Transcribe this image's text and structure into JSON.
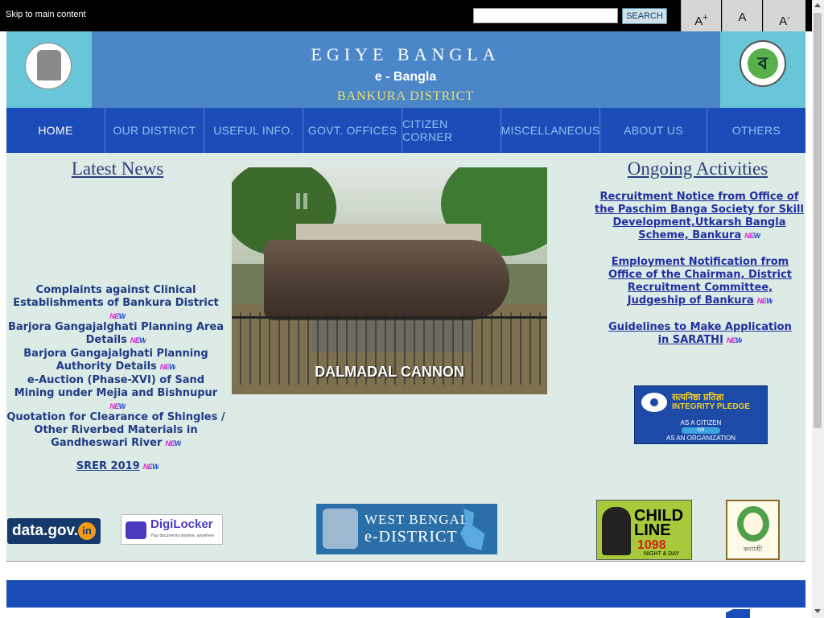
{
  "topbar": {
    "skip_link": "Skip to main content",
    "search_placeholder": "",
    "search_button": "SEARCH",
    "font_increase": "A",
    "font_increase_sup": "+",
    "font_normal": "A",
    "font_decrease": "A",
    "font_decrease_sup": "-"
  },
  "header": {
    "title": "EGIYE BANGLA",
    "subtitle": "e - Bangla",
    "district": "BANKURA DISTRICT",
    "left_emblem_icon": "state-emblem-icon",
    "right_logo_icon": "biswa-bangla-logo-icon",
    "right_logo_glyph": "ব"
  },
  "nav": {
    "items": [
      {
        "label": "HOME",
        "active": true
      },
      {
        "label": "OUR DISTRICT"
      },
      {
        "label": "USEFUL INFO."
      },
      {
        "label": "GOVT. OFFICES"
      },
      {
        "label": "CITIZEN CORNER"
      },
      {
        "label": "MISCELLANEOUS"
      },
      {
        "label": "ABOUT US"
      },
      {
        "label": "OTHERS"
      }
    ]
  },
  "latest_news": {
    "title": "Latest News",
    "badge": "NEW",
    "items": [
      "Complaints against Clinical Establishments of Bankura District",
      "Barjora Gangajalghati Planning Area Details",
      "Barjora Gangajalghati Planning Authority Details",
      "e-Auction (Phase-XVI) of Sand Mining under Mejia and Bishnupur",
      "Quotation for Clearance of Shingles / Other Riverbed Materials in Gandheswari River"
    ],
    "srer": "SRER 2019"
  },
  "slideshow": {
    "caption": "DALMADAL CANNON"
  },
  "ongoing": {
    "title": "Ongoing Activities",
    "items": [
      "Recruitment Notice from Office of the Paschim Banga Society for Skill Development,Utkarsh Bangla Scheme, Bankura",
      "Employment Notification from Office of the Chairman, District Recruitment Committee, Judgeship of Bankura",
      "Guidelines to Make Application in SARATHI"
    ]
  },
  "integrity": {
    "hindi": "सत्यनिष्ठा प्रतिज्ञा",
    "title": "INTEGRITY PLEDGE",
    "citizen": "AS A CITIZEN",
    "or": "OR",
    "organization": "AS AN ORGANIZATION"
  },
  "partners": {
    "datagov": "data.gov.",
    "datagov_in": "in",
    "digilocker": "DigiLocker",
    "digilocker_sub": "Your documents anytime, anywhere",
    "wbed_line1": "WEST BENGAL",
    "wbed_line2": "e-DISTRICT",
    "childline_1": "CHILD",
    "childline_2": "LINE",
    "childline_num": "1098",
    "childline_sub": "NIGHT & DAY",
    "kanyashree": "কন্যাশ্রী"
  },
  "colors": {
    "nav_bg": "#1a4db8",
    "header_bg": "#4a86c8",
    "content_bg": "#dcebe5"
  }
}
